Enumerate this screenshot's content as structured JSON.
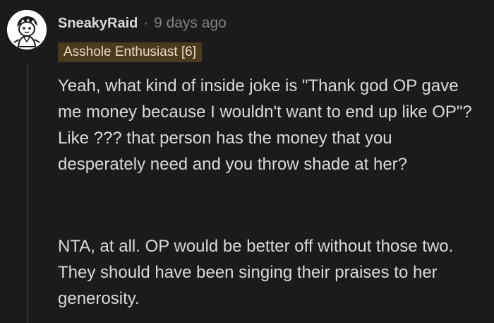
{
  "comment": {
    "username": "SneakyRaid",
    "separator": "·",
    "timestamp": "9 days ago",
    "flair": "Asshole Enthusiast [6]",
    "avatar_icon": "snoo-avatar-icon",
    "paragraphs": [
      "Yeah, what kind of inside joke is \"Thank god OP gave me money because I wouldn't want to end up like OP\"? Like ??? that person has the money that you desperately need and you throw shade at her?",
      "NTA, at all. OP would be better off without those two. They should have been singing their praises to her generosity."
    ]
  },
  "colors": {
    "background": "#1b1b1c",
    "text": "#d7dadc",
    "meta": "#818384",
    "flair_bg": "#4a3b1f",
    "thread_line": "#343536"
  }
}
